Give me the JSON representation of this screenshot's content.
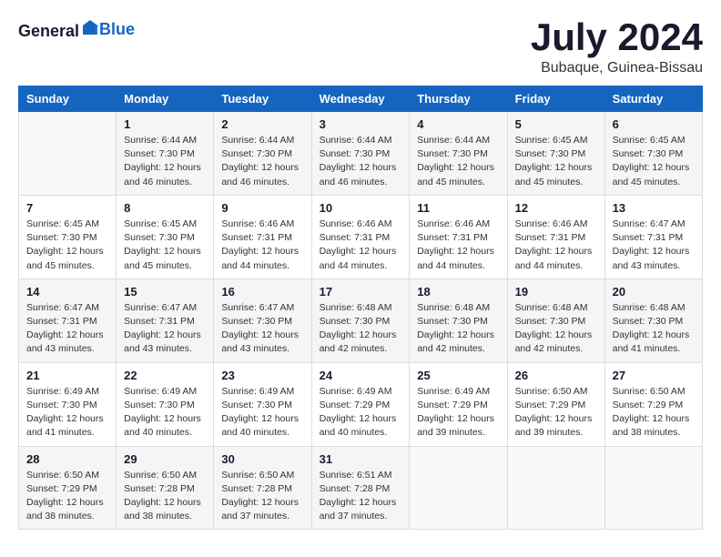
{
  "header": {
    "logo_general": "General",
    "logo_blue": "Blue",
    "month_year": "July 2024",
    "location": "Bubaque, Guinea-Bissau"
  },
  "days_of_week": [
    "Sunday",
    "Monday",
    "Tuesday",
    "Wednesday",
    "Thursday",
    "Friday",
    "Saturday"
  ],
  "weeks": [
    [
      {
        "day": "",
        "info": ""
      },
      {
        "day": "1",
        "info": "Sunrise: 6:44 AM\nSunset: 7:30 PM\nDaylight: 12 hours\nand 46 minutes."
      },
      {
        "day": "2",
        "info": "Sunrise: 6:44 AM\nSunset: 7:30 PM\nDaylight: 12 hours\nand 46 minutes."
      },
      {
        "day": "3",
        "info": "Sunrise: 6:44 AM\nSunset: 7:30 PM\nDaylight: 12 hours\nand 46 minutes."
      },
      {
        "day": "4",
        "info": "Sunrise: 6:44 AM\nSunset: 7:30 PM\nDaylight: 12 hours\nand 45 minutes."
      },
      {
        "day": "5",
        "info": "Sunrise: 6:45 AM\nSunset: 7:30 PM\nDaylight: 12 hours\nand 45 minutes."
      },
      {
        "day": "6",
        "info": "Sunrise: 6:45 AM\nSunset: 7:30 PM\nDaylight: 12 hours\nand 45 minutes."
      }
    ],
    [
      {
        "day": "7",
        "info": ""
      },
      {
        "day": "8",
        "info": "Sunrise: 6:45 AM\nSunset: 7:30 PM\nDaylight: 12 hours\nand 45 minutes."
      },
      {
        "day": "9",
        "info": "Sunrise: 6:46 AM\nSunset: 7:31 PM\nDaylight: 12 hours\nand 44 minutes."
      },
      {
        "day": "10",
        "info": "Sunrise: 6:46 AM\nSunset: 7:31 PM\nDaylight: 12 hours\nand 44 minutes."
      },
      {
        "day": "11",
        "info": "Sunrise: 6:46 AM\nSunset: 7:31 PM\nDaylight: 12 hours\nand 44 minutes."
      },
      {
        "day": "12",
        "info": "Sunrise: 6:46 AM\nSunset: 7:31 PM\nDaylight: 12 hours\nand 44 minutes."
      },
      {
        "day": "13",
        "info": "Sunrise: 6:47 AM\nSunset: 7:31 PM\nDaylight: 12 hours\nand 43 minutes."
      }
    ],
    [
      {
        "day": "14",
        "info": ""
      },
      {
        "day": "15",
        "info": "Sunrise: 6:47 AM\nSunset: 7:31 PM\nDaylight: 12 hours\nand 43 minutes."
      },
      {
        "day": "16",
        "info": "Sunrise: 6:47 AM\nSunset: 7:30 PM\nDaylight: 12 hours\nand 43 minutes."
      },
      {
        "day": "17",
        "info": "Sunrise: 6:48 AM\nSunset: 7:30 PM\nDaylight: 12 hours\nand 42 minutes."
      },
      {
        "day": "18",
        "info": "Sunrise: 6:48 AM\nSunset: 7:30 PM\nDaylight: 12 hours\nand 42 minutes."
      },
      {
        "day": "19",
        "info": "Sunrise: 6:48 AM\nSunset: 7:30 PM\nDaylight: 12 hours\nand 42 minutes."
      },
      {
        "day": "20",
        "info": "Sunrise: 6:48 AM\nSunset: 7:30 PM\nDaylight: 12 hours\nand 41 minutes."
      }
    ],
    [
      {
        "day": "21",
        "info": ""
      },
      {
        "day": "22",
        "info": "Sunrise: 6:49 AM\nSunset: 7:30 PM\nDaylight: 12 hours\nand 40 minutes."
      },
      {
        "day": "23",
        "info": "Sunrise: 6:49 AM\nSunset: 7:30 PM\nDaylight: 12 hours\nand 40 minutes."
      },
      {
        "day": "24",
        "info": "Sunrise: 6:49 AM\nSunset: 7:29 PM\nDaylight: 12 hours\nand 40 minutes."
      },
      {
        "day": "25",
        "info": "Sunrise: 6:49 AM\nSunset: 7:29 PM\nDaylight: 12 hours\nand 39 minutes."
      },
      {
        "day": "26",
        "info": "Sunrise: 6:50 AM\nSunset: 7:29 PM\nDaylight: 12 hours\nand 39 minutes."
      },
      {
        "day": "27",
        "info": "Sunrise: 6:50 AM\nSunset: 7:29 PM\nDaylight: 12 hours\nand 38 minutes."
      }
    ],
    [
      {
        "day": "28",
        "info": "Sunrise: 6:50 AM\nSunset: 7:29 PM\nDaylight: 12 hours\nand 38 minutes."
      },
      {
        "day": "29",
        "info": "Sunrise: 6:50 AM\nSunset: 7:28 PM\nDaylight: 12 hours\nand 38 minutes."
      },
      {
        "day": "30",
        "info": "Sunrise: 6:50 AM\nSunset: 7:28 PM\nDaylight: 12 hours\nand 37 minutes."
      },
      {
        "day": "31",
        "info": "Sunrise: 6:51 AM\nSunset: 7:28 PM\nDaylight: 12 hours\nand 37 minutes."
      },
      {
        "day": "",
        "info": ""
      },
      {
        "day": "",
        "info": ""
      },
      {
        "day": "",
        "info": ""
      }
    ]
  ],
  "week7_day7_info": "Sunrise: 6:45 AM\nSunset: 7:30 PM\nDaylight: 12 hours\nand 45 minutes.",
  "week14_day14_info": "Sunrise: 6:47 AM\nSunset: 7:31 PM\nDaylight: 12 hours\nand 43 minutes.",
  "week21_day21_info": "Sunrise: 6:49 AM\nSunset: 7:30 PM\nDaylight: 12 hours\nand 41 minutes."
}
